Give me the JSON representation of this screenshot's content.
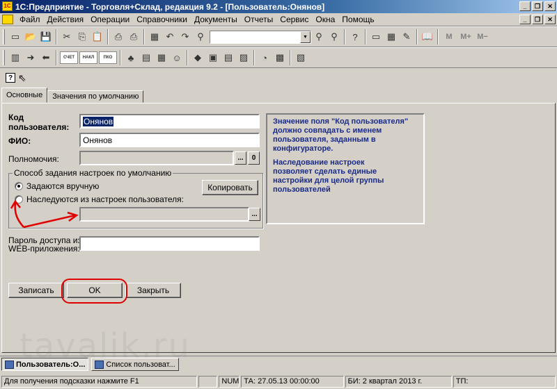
{
  "window": {
    "title": "1С:Предприятие - Торговля+Склад, редакция 9.2 - [Пользователь:Онянов]",
    "app_icon_label": "1С",
    "controls": [
      "_",
      "❐",
      "✕"
    ]
  },
  "menu": {
    "items": [
      "Файл",
      "Действия",
      "Операции",
      "Справочники",
      "Документы",
      "Отчеты",
      "Сервис",
      "Окна",
      "Помощь"
    ],
    "mdi_controls": [
      "_",
      "❐",
      "✕"
    ]
  },
  "toolbar": {
    "m_buttons": [
      "M",
      "M+",
      "M−"
    ],
    "doc_buttons": [
      "СЧЕТ",
      "НАКЛ",
      "ПКО"
    ]
  },
  "tabs": [
    {
      "label": "Основные",
      "active": true
    },
    {
      "label": "Значения по умолчанию",
      "active": false
    }
  ],
  "form": {
    "code_label_line1": "Код",
    "code_label_line2": "пользователя:",
    "code_value": "Онянов",
    "fio_label": "ФИО:",
    "fio_value": "Онянов",
    "rights_label": "Полномочия:",
    "rights_value": "",
    "rights_select_button": "...",
    "rights_clear_button": "0",
    "group_title": "Способ задания настроек по умолчанию",
    "radio_manual": "Задаются вручную",
    "radio_inherit": "Наследуются из настроек пользователя:",
    "inherit_value": "",
    "inherit_select_button": "...",
    "copy_button": "Копировать",
    "web_label_line1": "Пароль доступа из",
    "web_label_line2": "WEB-приложения:",
    "web_value": "",
    "save_button": "Записать",
    "ok_button": "OK",
    "close_button": "Закрыть"
  },
  "info": {
    "p1": [
      "Значение поля \"Код пользователя\"",
      "должно совпадать с именем",
      "пользователя, заданным в",
      "конфигураторе."
    ],
    "p2": [
      "Наследование настроек",
      "позволяет сделать единые",
      "настройки для целой группы",
      "пользователей"
    ]
  },
  "taskbar": [
    {
      "label": "Пользователь:О...",
      "active": true
    },
    {
      "label": "Список пользоват...",
      "active": false
    }
  ],
  "status": {
    "hint": "Для получения подсказки нажмите F1",
    "num": "NUM",
    "ta": "ТА: 27.05.13  00:00:00",
    "bi": "БИ: 2 квартал 2013 г.",
    "tp": "ТП:"
  },
  "watermark": "tavalik.ru",
  "colors": {
    "accent": "#0a246a",
    "info_text": "#1a2a8a",
    "annotation": "#e00000"
  }
}
